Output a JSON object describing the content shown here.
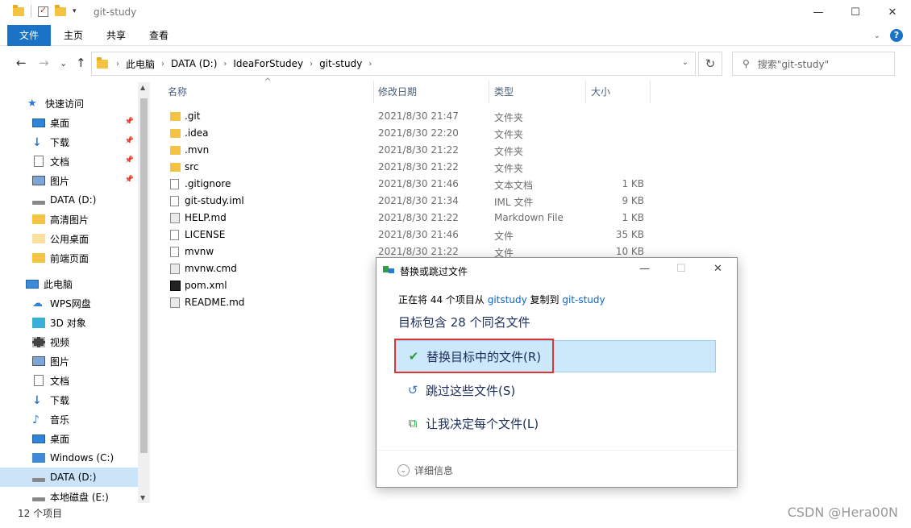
{
  "window": {
    "title": "git-study",
    "controls": {
      "minimize": "—",
      "maximize": "☐",
      "close": "✕"
    }
  },
  "ribbon": {
    "tabs": [
      "文件",
      "主页",
      "共享",
      "查看"
    ],
    "help": "?"
  },
  "nav": {
    "back": "←",
    "forward": "→",
    "recent": "⌄",
    "up": "↑",
    "breadcrumbs": [
      "此电脑",
      "DATA (D:)",
      "IdeaForStudey",
      "git-study"
    ],
    "search_placeholder": "搜索\"git-study\""
  },
  "sidebar": {
    "items": [
      {
        "label": "快速访问",
        "icon": "star-icon"
      },
      {
        "label": "桌面",
        "icon": "desktop-icon",
        "pinned": true
      },
      {
        "label": "下载",
        "icon": "download-icon",
        "pinned": true
      },
      {
        "label": "文档",
        "icon": "document-icon",
        "pinned": true
      },
      {
        "label": "图片",
        "icon": "picture-icon",
        "pinned": true
      },
      {
        "label": "DATA (D:)",
        "icon": "drive-icon"
      },
      {
        "label": "高清图片",
        "icon": "folder-icon"
      },
      {
        "label": "公用桌面",
        "icon": "folder-icon"
      },
      {
        "label": "前端页面",
        "icon": "folder-icon"
      },
      {
        "label": "此电脑",
        "icon": "computer-icon"
      },
      {
        "label": "WPS网盘",
        "icon": "cloud-icon"
      },
      {
        "label": "3D 对象",
        "icon": "cube-icon"
      },
      {
        "label": "视频",
        "icon": "video-icon"
      },
      {
        "label": "图片",
        "icon": "picture-icon"
      },
      {
        "label": "文档",
        "icon": "document-icon"
      },
      {
        "label": "下载",
        "icon": "download-icon"
      },
      {
        "label": "音乐",
        "icon": "music-icon"
      },
      {
        "label": "桌面",
        "icon": "desktop-icon"
      },
      {
        "label": "Windows (C:)",
        "icon": "windows-drive-icon"
      },
      {
        "label": "DATA (D:)",
        "icon": "drive-icon",
        "selected": true
      },
      {
        "label": "本地磁盘 (E:)",
        "icon": "drive-icon"
      }
    ]
  },
  "columns": {
    "name": "名称",
    "date": "修改日期",
    "type": "类型",
    "size": "大小"
  },
  "files": [
    {
      "name": ".git",
      "date": "2021/8/30 21:47",
      "type": "文件夹",
      "size": "",
      "icon": "folder-icon"
    },
    {
      "name": ".idea",
      "date": "2021/8/30 22:20",
      "type": "文件夹",
      "size": "",
      "icon": "folder-icon"
    },
    {
      "name": ".mvn",
      "date": "2021/8/30 21:22",
      "type": "文件夹",
      "size": "",
      "icon": "folder-icon"
    },
    {
      "name": "src",
      "date": "2021/8/30 21:22",
      "type": "文件夹",
      "size": "",
      "icon": "folder-icon"
    },
    {
      "name": ".gitignore",
      "date": "2021/8/30 21:46",
      "type": "文本文档",
      "size": "1 KB",
      "icon": "text-file-icon"
    },
    {
      "name": "git-study.iml",
      "date": "2021/8/30 21:34",
      "type": "IML 文件",
      "size": "9 KB",
      "icon": "file-icon"
    },
    {
      "name": "HELP.md",
      "date": "2021/8/30 21:22",
      "type": "Markdown File",
      "size": "1 KB",
      "icon": "markdown-file-icon"
    },
    {
      "name": "LICENSE",
      "date": "2021/8/30 21:46",
      "type": "文件",
      "size": "35 KB",
      "icon": "file-icon"
    },
    {
      "name": "mvnw",
      "date": "2021/8/30 21:22",
      "type": "文件",
      "size": "10 KB",
      "icon": "file-icon"
    },
    {
      "name": "mvnw.cmd",
      "date": "",
      "type": "",
      "size": "",
      "icon": "cmd-file-icon"
    },
    {
      "name": "pom.xml",
      "date": "",
      "type": "",
      "size": "",
      "icon": "intellij-file-icon"
    },
    {
      "name": "README.md",
      "date": "",
      "type": "",
      "size": "",
      "icon": "markdown-file-icon"
    }
  ],
  "status": {
    "count": "12 个项目"
  },
  "dialog": {
    "title": "替换或跳过文件",
    "info_prefix": "正在将 44 个项目从",
    "source": "gitstudy",
    "info_mid": "复制到",
    "dest": "git-study",
    "heading": "目标包含 28 个同名文件",
    "options": [
      {
        "label": "替换目标中的文件(R)",
        "icon": "checkmark-icon"
      },
      {
        "label": "跳过这些文件(S)",
        "icon": "skip-icon"
      },
      {
        "label": "让我决定每个文件(L)",
        "icon": "decide-icon"
      }
    ],
    "details": "详细信息"
  },
  "watermark": "CSDN @Hera00N"
}
